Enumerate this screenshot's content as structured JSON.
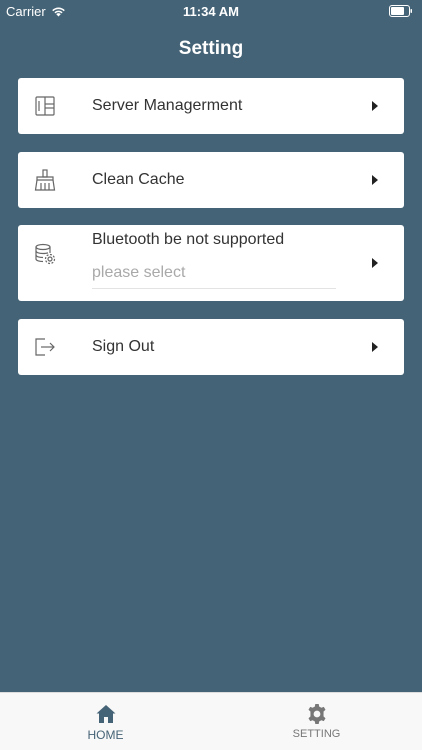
{
  "status_bar": {
    "carrier": "Carrier",
    "time": "11:34 AM"
  },
  "header": {
    "title": "Setting"
  },
  "menu": {
    "server": {
      "label": "Server Managerment",
      "icon": "server-panel-icon"
    },
    "cache": {
      "label": "Clean Cache",
      "icon": "broom-icon"
    },
    "bluetooth": {
      "label": "Bluetooth be not supported",
      "placeholder": "please select",
      "icon": "database-gear-icon"
    },
    "signout": {
      "label": "Sign Out",
      "icon": "sign-out-icon"
    }
  },
  "tab_bar": {
    "home": {
      "label": "HOME",
      "icon": "home-icon",
      "active": true
    },
    "setting": {
      "label": "SETTING",
      "icon": "gear-icon",
      "active": false
    }
  },
  "colors": {
    "background": "#456376",
    "card": "#ffffff",
    "active_tab": "#456376",
    "inactive_tab": "#777777"
  }
}
